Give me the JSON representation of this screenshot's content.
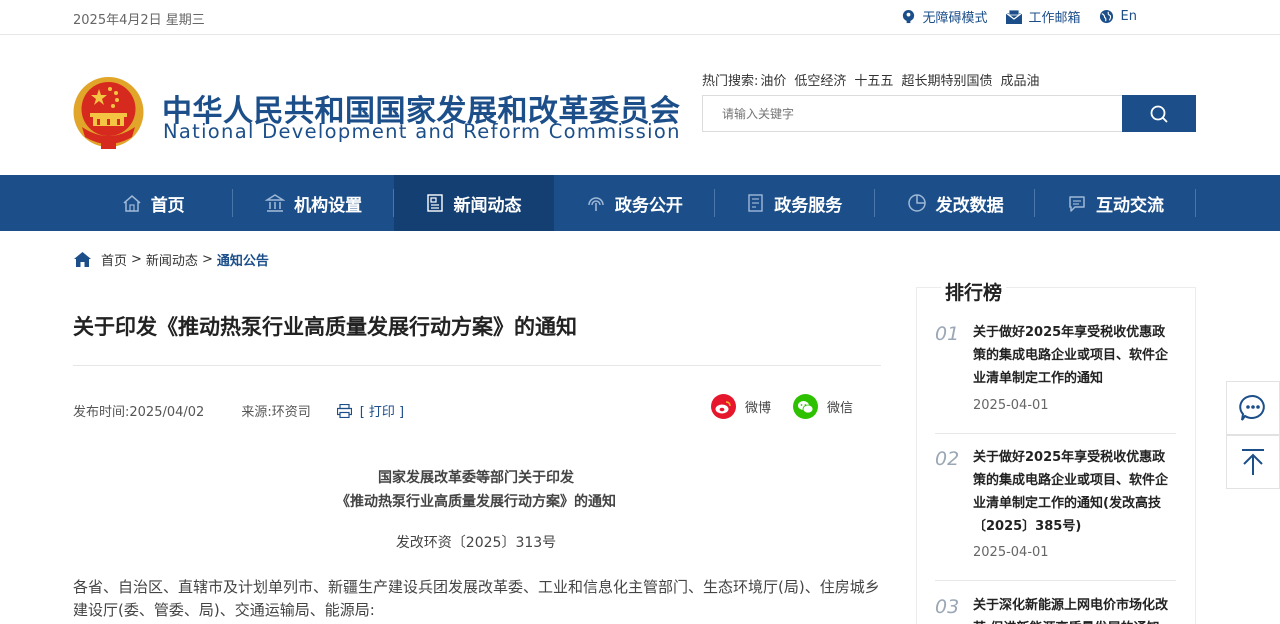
{
  "topbar": {
    "date": "2025年4月2日 星期三",
    "accessibility": "无障碍模式",
    "mail": "工作邮箱",
    "lang": "En"
  },
  "header": {
    "title_cn": "中华人民共和国国家发展和改革委员会",
    "title_en": "National Development and Reform Commission",
    "hot_label": "热门搜索:",
    "hot_items": [
      "油价",
      "低空经济",
      "十五五",
      "超长期特别国债",
      "成品油"
    ],
    "search_placeholder": "请输入关键字"
  },
  "nav": [
    {
      "label": "首页",
      "icon": "home-icon"
    },
    {
      "label": "机构设置",
      "icon": "building-icon"
    },
    {
      "label": "新闻动态",
      "icon": "news-icon",
      "active": true
    },
    {
      "label": "政务公开",
      "icon": "broadcast-icon"
    },
    {
      "label": "政务服务",
      "icon": "document-icon"
    },
    {
      "label": "发改数据",
      "icon": "pie-chart-icon"
    },
    {
      "label": "互动交流",
      "icon": "chat-icon"
    }
  ],
  "breadcrumb": {
    "items": [
      "首页",
      "新闻动态"
    ],
    "separator": ">",
    "current": "通知公告"
  },
  "article": {
    "title": "关于印发《推动热泵行业高质量发展行动方案》的通知",
    "publish": "发布时间:2025/04/02",
    "source": "来源:环资司",
    "print": "[ 打印 ]",
    "share_weibo": "微博",
    "share_wechat": "微信",
    "doc_title_line1": "国家发展改革委等部门关于印发",
    "doc_title_line2": "《推动热泵行业高质量发展行动方案》的通知",
    "doc_number": "发改环资〔2025〕313号",
    "body": "各省、自治区、直辖市及计划单列市、新疆生产建设兵团发展改革委、工业和信息化主管部门、生态环境厅(局)、住房城乡建设厅(委、管委、局)、交通运输局、能源局:"
  },
  "ranking": {
    "title": "排行榜",
    "items": [
      {
        "num": "01",
        "title": "关于做好2025年享受税收优惠政策的集成电路企业或项目、软件企业清单制定工作的通知",
        "date": "2025-04-01"
      },
      {
        "num": "02",
        "title": "关于做好2025年享受税收优惠政策的集成电路企业或项目、软件企业清单制定工作的通知(发改高技〔2025〕385号)",
        "date": "2025-04-01"
      },
      {
        "num": "03",
        "title": "关于深化新能源上网电价市场化改革 促进新能源高质量发展的通知",
        "date": ""
      }
    ]
  },
  "colors": {
    "brand": "#1c4f8a",
    "nav_active": "#143f72",
    "weibo": "#e6162d",
    "wechat": "#2dc100"
  }
}
